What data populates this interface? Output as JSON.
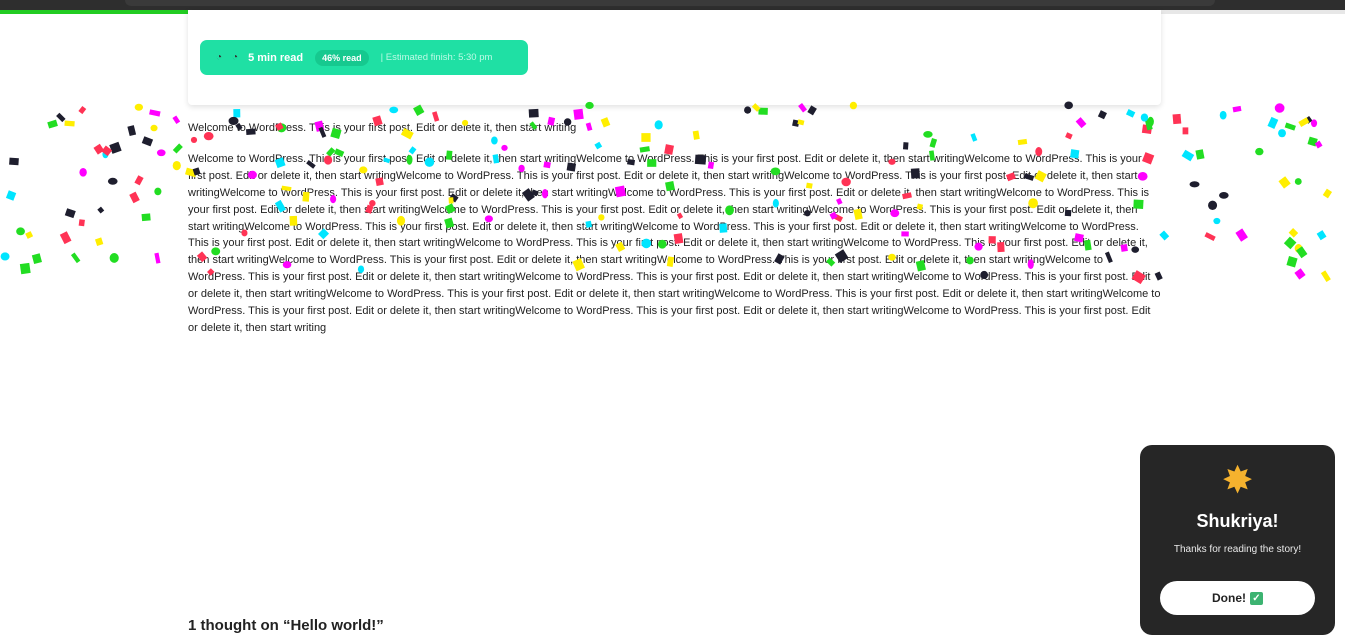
{
  "reading_progress": {
    "percent": 46,
    "color": "#22cc22"
  },
  "reading_bar": {
    "clock_icon_1": "clock-icon",
    "clock_icon_2": "clock-icon",
    "read_time": "5 min read",
    "percent_badge": "46% read",
    "estimated_finish": "| Estimated finish: 5:30 pm",
    "accent": "#1fe0a4"
  },
  "article": {
    "intro": "Welcome to WordPress. This is your first post. Edit or delete it, then start writing",
    "body_repeat": "Welcome to WordPress. This is your first post. Edit or delete it, then start writing",
    "body_repeat_count": 25
  },
  "comments": {
    "title": "1 thought on “Hello world!”"
  },
  "toast": {
    "icon": "star-icon",
    "icon_glyph": "✸",
    "title": "Shukriya!",
    "subtitle": "Thanks for reading the story!",
    "done_label": "Done!",
    "done_check": "✓"
  },
  "confetti_colors": [
    "#ff00ff",
    "#00e5ff",
    "#ff3355",
    "#ffee00",
    "#22dd22",
    "#1e1e2e"
  ]
}
